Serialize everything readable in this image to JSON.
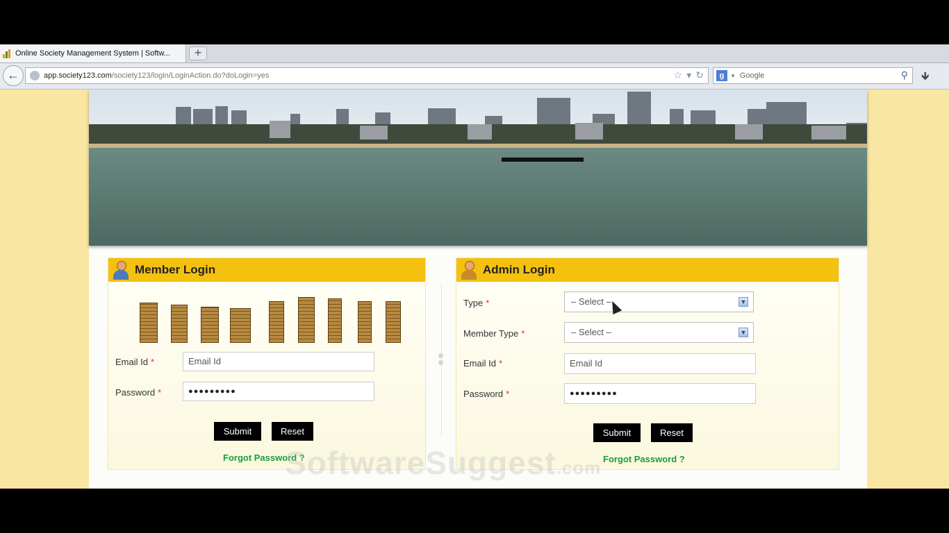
{
  "browser": {
    "tab_title": "Online Society Management System | Softw...",
    "new_tab_label": "+",
    "url_host": "app.society123.com",
    "url_path": "/society123/login/LoginAction.do?doLogin=yes",
    "search_placeholder": "Google",
    "icons": [
      "back-arrow-icon",
      "globe-icon",
      "star-icon",
      "reload-icon",
      "google-icon",
      "search-icon",
      "download-icon"
    ]
  },
  "member_login": {
    "title": "Member Login",
    "email_label": "Email Id",
    "email_placeholder": "Email Id",
    "password_label": "Password",
    "password_value": "●●●●●●●●●",
    "required_mark": "*",
    "submit_label": "Submit",
    "reset_label": "Reset",
    "forgot_label": "Forgot Password ?"
  },
  "admin_login": {
    "title": "Admin Login",
    "type_label": "Type",
    "type_value": "– Select –",
    "member_type_label": "Member Type",
    "member_type_value": "– Select –",
    "email_label": "Email Id",
    "email_placeholder": "Email Id",
    "password_label": "Password",
    "password_value": "●●●●●●●●●",
    "required_mark": "*",
    "submit_label": "Submit",
    "reset_label": "Reset",
    "forgot_label": "Forgot Password ?"
  },
  "watermark": {
    "text": "SoftwareSuggest",
    "suffix": ".com"
  },
  "colors": {
    "page_background": "#fae6a3",
    "header_yellow": "#f5c10f",
    "link_green": "#1a9e3a",
    "button_black": "#000000"
  }
}
